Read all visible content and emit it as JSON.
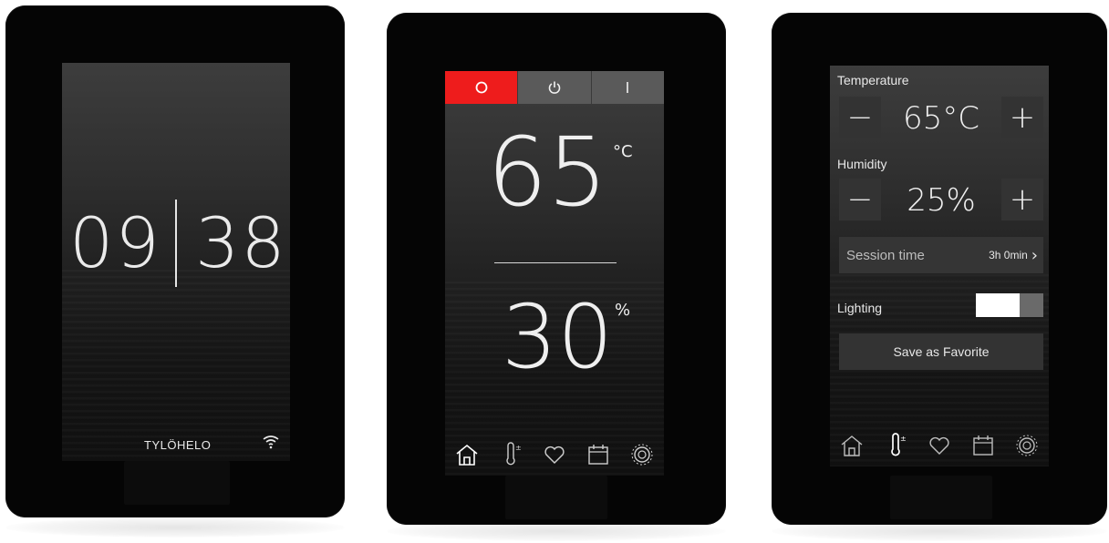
{
  "device1": {
    "clock": {
      "hour": "09",
      "minute": "38"
    },
    "brand": "TYLÖHELO",
    "status_icon": "wifi-icon"
  },
  "device2": {
    "modes": [
      {
        "icon": "ring-icon",
        "active": true
      },
      {
        "icon": "power-icon",
        "active": false
      },
      {
        "icon": "bar-icon",
        "active": false
      }
    ],
    "temperature": {
      "value": "65",
      "unit": "°C"
    },
    "humidity": {
      "value": "30",
      "unit": "%"
    },
    "nav": [
      "home-icon",
      "thermometer-icon",
      "heart-icon",
      "calendar-icon",
      "gear-icon"
    ],
    "active_nav": "home-icon"
  },
  "device3": {
    "temperature": {
      "label": "Temperature",
      "value": "65°C",
      "minus": "−",
      "plus": "+"
    },
    "humidity": {
      "label": "Humidity",
      "value": "25%",
      "minus": "−",
      "plus": "+"
    },
    "session": {
      "label": "Session time",
      "value": "3h 0min",
      "chevron": "›"
    },
    "lighting": {
      "label": "Lighting",
      "on": true
    },
    "favorite_button": "Save as Favorite",
    "nav": [
      "home-icon",
      "thermometer-icon",
      "heart-icon",
      "calendar-icon",
      "gear-icon"
    ],
    "active_nav": "thermometer-icon"
  },
  "colors": {
    "accent": "#ee1c1c",
    "text": "#efefef",
    "panel": "#333333"
  }
}
